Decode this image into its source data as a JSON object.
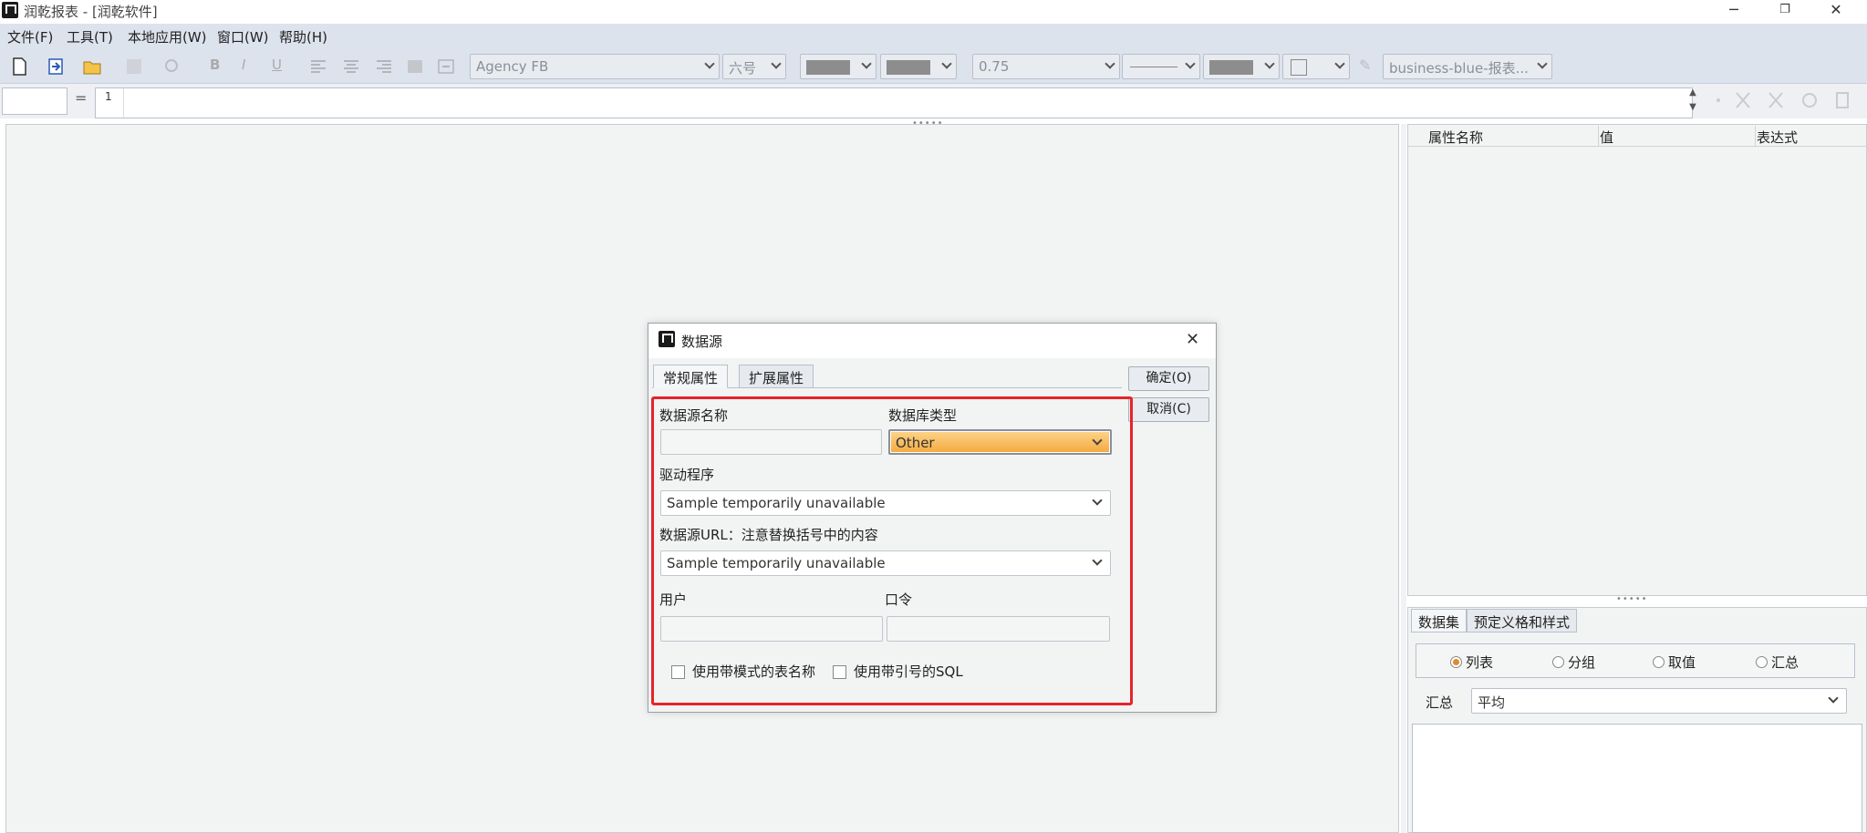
{
  "window": {
    "title": "润乾报表 - [润乾软件]",
    "minimize": "─",
    "restore": "❐",
    "close": "✕"
  },
  "menu": [
    "文件(F)",
    "工具(T)",
    "本地应用(W)",
    "窗口(W)",
    "帮助(H)"
  ],
  "toolbar": {
    "font": "Agency FB",
    "font_size": "六号",
    "line_width": "0.75",
    "style_theme": "business-blue-报表..."
  },
  "formula_bar": {
    "cell_ref": "",
    "equals": "=",
    "row_number": "1",
    "value": ""
  },
  "property_panel": {
    "headers": [
      "属性名称",
      "值",
      "表达式"
    ]
  },
  "dataset_panel": {
    "tabs": [
      "数据集",
      "预定义格和样式"
    ],
    "radio_options": [
      "列表",
      "分组",
      "取值",
      "汇总"
    ],
    "selected_radio": "列表",
    "summary_label": "汇总",
    "summary_value": "平均"
  },
  "dialog": {
    "title": "数据源",
    "close_glyph": "✕",
    "tabs": [
      "常规属性",
      "扩展属性"
    ],
    "ok_label": "确定(O)",
    "cancel_label": "取消(C)",
    "ds_name_label": "数据源名称",
    "ds_name_value": "",
    "db_type_label": "数据库类型",
    "db_type_value": "Other",
    "driver_label": "驱动程序",
    "driver_value": "Sample temporarily unavailable",
    "url_label": "数据源URL：注意替换括号中的内容",
    "url_value": "Sample temporarily unavailable",
    "user_label": "用户",
    "user_value": "",
    "password_label": "口令",
    "password_value": "",
    "checkbox_schema": "使用带模式的表名称",
    "checkbox_quoted_sql": "使用带引号的SQL",
    "highlight_color": "#e8232a",
    "accent_color": "#f5a93e"
  }
}
